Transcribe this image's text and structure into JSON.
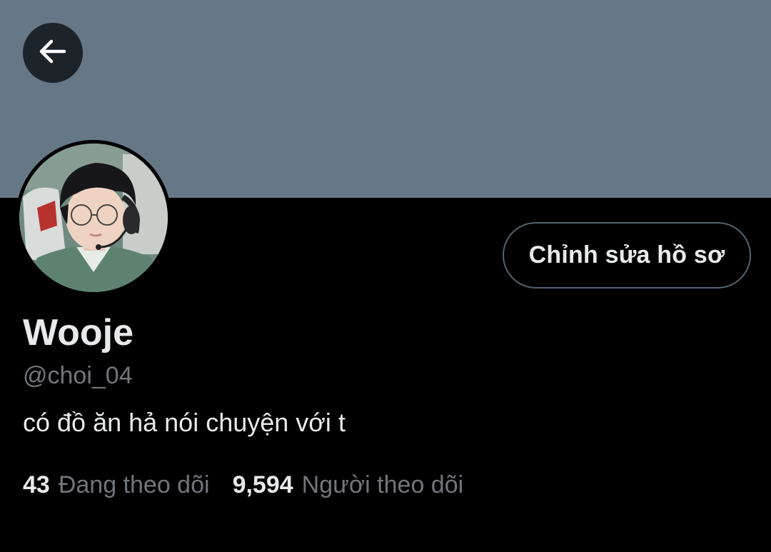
{
  "header": {
    "back_icon": "arrow-left-icon",
    "banner_color": "#667786"
  },
  "profile": {
    "avatar_icon": "profile-photo",
    "edit_button_label": "Chỉnh sửa hồ sơ",
    "display_name": "Wooje",
    "handle": "@choi_04",
    "bio": "có đồ ăn hả nói chuyện với t"
  },
  "stats": {
    "following_count": "43",
    "following_label": "Đang theo dõi",
    "followers_count": "9,594",
    "followers_label": "Người theo dõi"
  },
  "colors": {
    "background": "#000000",
    "primary_text": "#e7e9ea",
    "secondary_text": "#71767b",
    "button_border": "#536471"
  }
}
